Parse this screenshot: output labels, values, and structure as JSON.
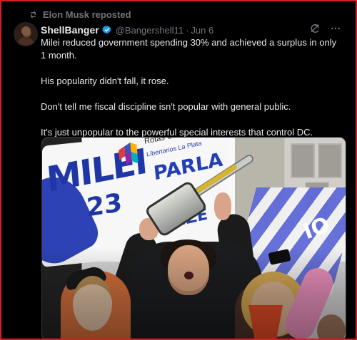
{
  "repost": {
    "icon": "repost-icon",
    "label": "Elon Musk reposted"
  },
  "tweet": {
    "display_name": "ShellBanger",
    "handle": "@Bangershell11",
    "separator": "·",
    "date": "Jun 6",
    "verified_color": "#1d9bf0",
    "paragraphs": [
      "Milei reduced government spending 30% and achieved a surplus in only 1 month.",
      "His popularity didn't fall, it rose.",
      "Don't tell me fiscal discipline isn't popular with general public.",
      "It's just unpopular to the powerful special interests that control DC."
    ]
  },
  "icons": {
    "grok": "grok-icon",
    "more": "more-icon",
    "verified": "verified-badge-icon"
  },
  "photo": {
    "sign_large_text": "MILEI",
    "sign_number": "23",
    "sign_rotas": "Rotas Cauc",
    "sign_libertarios": "Libertarios La Plata",
    "sign_parla": "PARLA",
    "sign_lower": "GONZE",
    "flag_text": "IO"
  },
  "colors": {
    "background": "#000000",
    "border": "#d61f1f",
    "text_primary": "#e7e9ea",
    "text_secondary": "#71767b"
  }
}
